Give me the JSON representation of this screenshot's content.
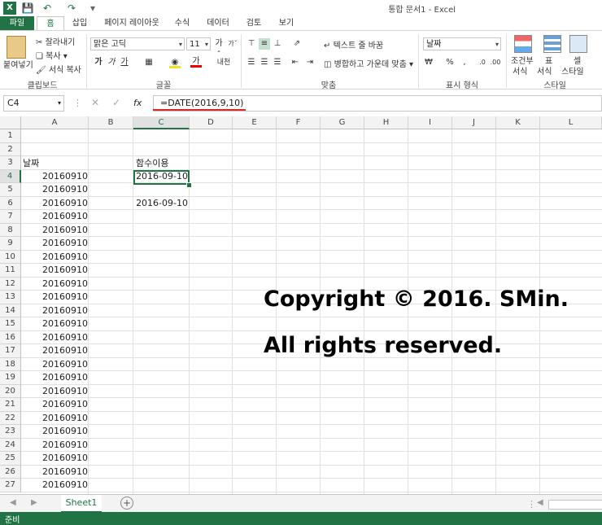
{
  "window": {
    "title": "통합 문서1 - Excel"
  },
  "tabs": [
    "파일",
    "홈",
    "삽입",
    "페이지 레이아웃",
    "수식",
    "데이터",
    "검토",
    "보기"
  ],
  "ribbon": {
    "clipboard": {
      "paste": "붙여넣기",
      "cut": "잘라내기",
      "copy": "복사",
      "format_painter": "서식 복사",
      "group": "클립보드"
    },
    "font": {
      "name": "맑은 고딕",
      "size": "11",
      "bold": "가",
      "italic": "가",
      "underline": "가",
      "font_color": "가",
      "phonetic": "내천",
      "group": "글꼴"
    },
    "alignment": {
      "wrap": "텍스트 줄 바꿈",
      "merge": "병합하고 가운데 맞춤",
      "group": "맞춤"
    },
    "number": {
      "format": "날짜",
      "percent": "%",
      "group": "표시 형식"
    },
    "styles": {
      "conditional": "조건부",
      "conditional2": "서식",
      "table": "표",
      "table2": "서식",
      "cell": "셀",
      "cell2": "스타일",
      "group": "스타일"
    }
  },
  "formula_bar": {
    "name_box": "C4",
    "fx": "fx",
    "formula": "=DATE(2016,9,10)"
  },
  "grid": {
    "columns": [
      "A",
      "B",
      "C",
      "D",
      "E",
      "F",
      "G",
      "H",
      "I",
      "J",
      "K",
      "L"
    ],
    "rows": [
      "1",
      "2",
      "3",
      "4",
      "5",
      "6",
      "7",
      "8",
      "9",
      "10",
      "11",
      "12",
      "13",
      "14",
      "15",
      "16",
      "17",
      "18",
      "19",
      "20",
      "21",
      "22",
      "23",
      "24",
      "25",
      "26",
      "27"
    ],
    "header_a": "날짜",
    "header_c": "함수이용",
    "a_value": "20160910",
    "c4": "2016-09-10",
    "c6": "2016-09-10"
  },
  "watermark": {
    "line1": "Copyright © 2016. SMin.",
    "line2": "All rights reserved."
  },
  "sheets": {
    "active": "Sheet1"
  },
  "status": {
    "ready": "준비"
  },
  "colors": {
    "accent": "#217346",
    "underline": "#d62828"
  }
}
